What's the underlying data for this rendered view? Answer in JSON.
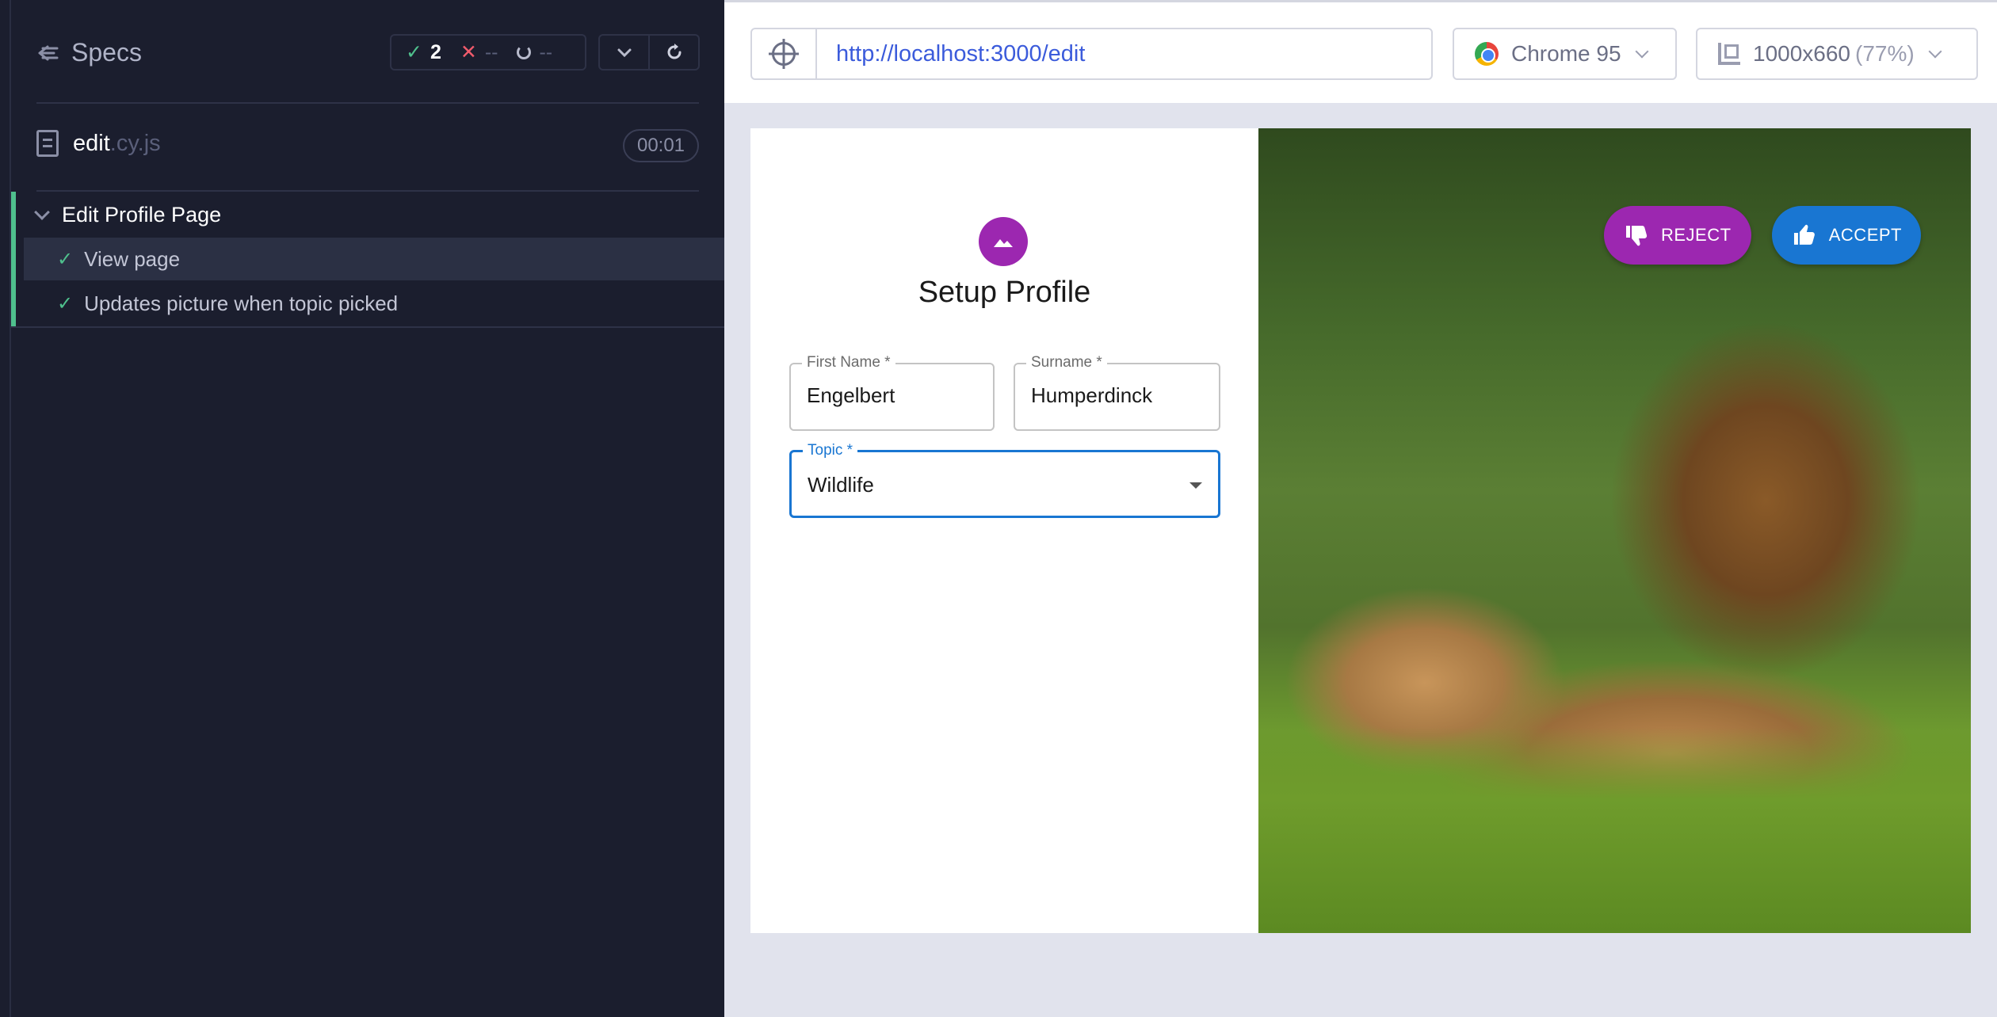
{
  "reporter": {
    "header_title": "Specs",
    "stats": {
      "passed": "2",
      "failed": "--",
      "pending": "--"
    },
    "spec_file": {
      "name": "edit",
      "ext": ".cy.js",
      "duration": "00:01"
    },
    "suite": {
      "title": "Edit Profile Page",
      "tests": [
        {
          "label": "View page",
          "status": "passed"
        },
        {
          "label": "Updates picture when topic picked",
          "status": "passed"
        }
      ]
    }
  },
  "aut_bar": {
    "url": "http://localhost:3000/edit",
    "browser": "Chrome 95",
    "viewport": "1000x660",
    "viewport_scale": "(77%)"
  },
  "app": {
    "title": "Setup Profile",
    "fields": {
      "first_name": {
        "label": "First Name *",
        "value": "Engelbert"
      },
      "surname": {
        "label": "Surname *",
        "value": "Humperdinck"
      },
      "topic": {
        "label": "Topic *",
        "value": "Wildlife"
      }
    },
    "reject_label": "REJECT",
    "accept_label": "ACCEPT"
  },
  "colors": {
    "reporter_bg": "#1b1e2e",
    "pass_green": "#4fc08d",
    "fail_red": "#f15b6c",
    "url_blue": "#3b5bdb",
    "reject_purple": "#9c27b0",
    "accept_blue": "#1976d2"
  }
}
